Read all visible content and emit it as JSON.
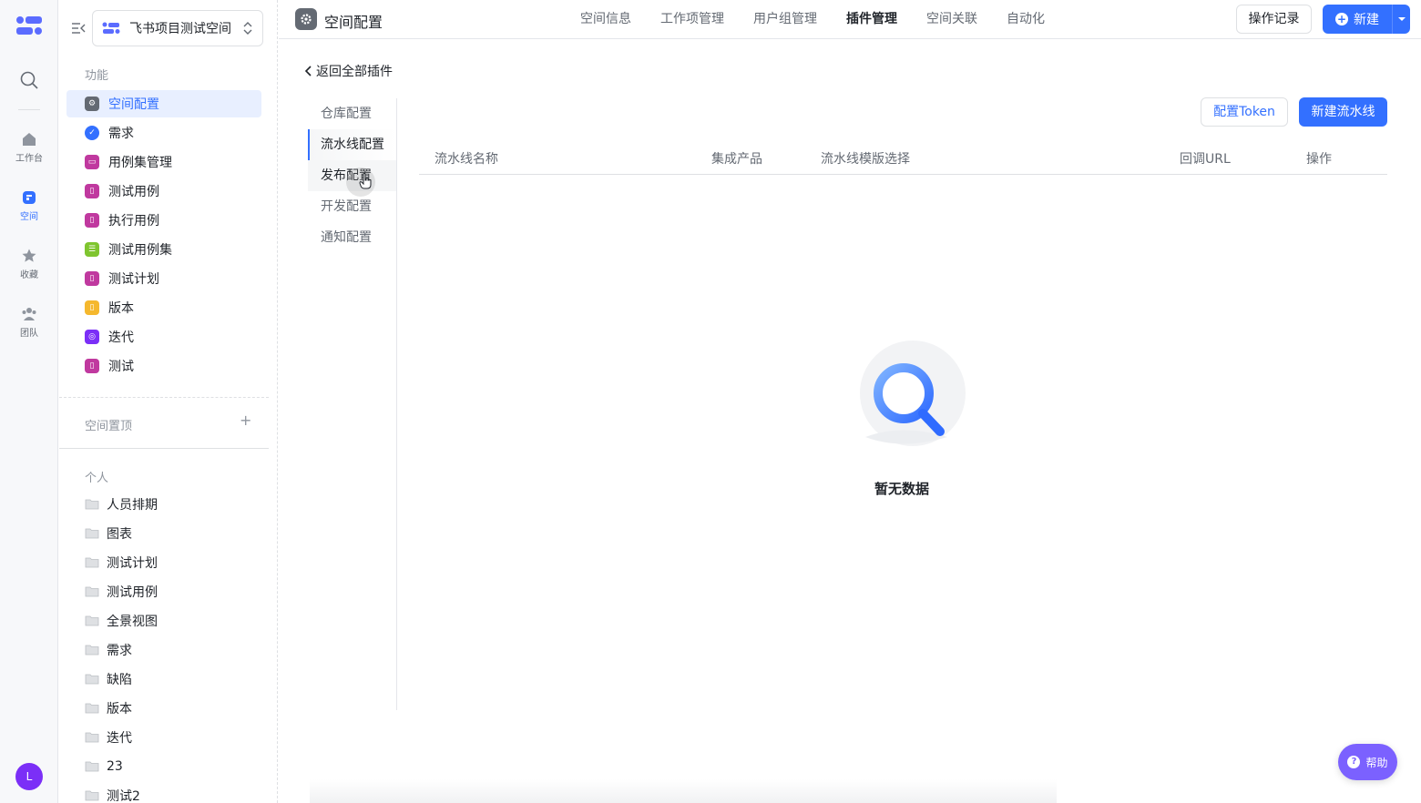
{
  "rail": {
    "items": [
      {
        "label": "工作台",
        "icon": "home-icon"
      },
      {
        "label": "空间",
        "icon": "space-icon"
      },
      {
        "label": "收藏",
        "icon": "star-icon"
      },
      {
        "label": "团队",
        "icon": "team-icon"
      }
    ],
    "avatar": "L"
  },
  "sidebar": {
    "space_name": "飞书项目测试空间",
    "section_features": "功能",
    "features": [
      {
        "label": "空间配置",
        "color": "#646a73",
        "icon": "gear-icon"
      },
      {
        "label": "需求",
        "color": "#3370ff",
        "icon": "check-icon"
      },
      {
        "label": "用例集管理",
        "color": "#c0399f",
        "icon": "folder-icon"
      },
      {
        "label": "测试用例",
        "color": "#c0399f",
        "icon": "bookmark-icon"
      },
      {
        "label": "执行用例",
        "color": "#c0399f",
        "icon": "bookmark-icon"
      },
      {
        "label": "测试用例集",
        "color": "#7fc52f",
        "icon": "list-icon"
      },
      {
        "label": "测试计划",
        "color": "#c0399f",
        "icon": "bookmark-icon"
      },
      {
        "label": "版本",
        "color": "#f5b82e",
        "icon": "bookmark-icon"
      },
      {
        "label": "迭代",
        "color": "#7b2ff7",
        "icon": "cycle-icon"
      },
      {
        "label": "测试",
        "color": "#c0399f",
        "icon": "bookmark-icon"
      }
    ],
    "section_pinned": "空间置顶",
    "section_personal": "个人",
    "personal": [
      "人员排期",
      "图表",
      "测试计划",
      "测试用例",
      "全景视图",
      "需求",
      "缺陷",
      "版本",
      "迭代",
      "23",
      "测试2"
    ]
  },
  "topbar": {
    "title": "空间配置",
    "tabs": [
      "空间信息",
      "工作项管理",
      "用户组管理",
      "插件管理",
      "空间关联",
      "自动化"
    ],
    "active_tab": "插件管理",
    "log_button": "操作记录",
    "new_button": "新建"
  },
  "content": {
    "back_link": "返回全部插件",
    "subnav": [
      "仓库配置",
      "流水线配置",
      "发布配置",
      "开发配置",
      "通知配置"
    ],
    "token_button": "配置Token",
    "new_pipeline_button": "新建流水线",
    "table_headers": [
      "流水线名称",
      "集成产品",
      "流水线模版选择",
      "回调URL",
      "操作"
    ],
    "empty_text": "暂无数据"
  },
  "help": {
    "label": "帮助"
  },
  "colors": {
    "accent": "#3370ff",
    "help": "#7b61ff"
  }
}
